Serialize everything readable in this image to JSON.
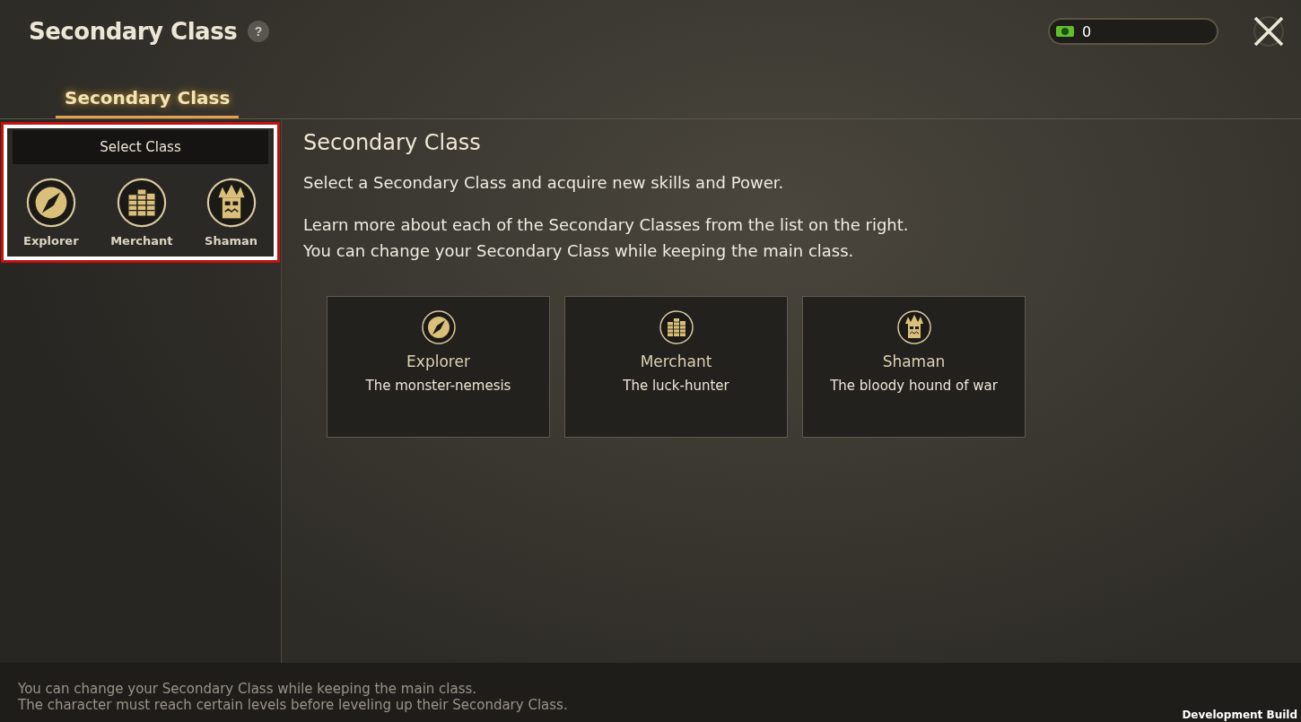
{
  "header": {
    "title": "Secondary Class",
    "help": "?",
    "currency": "0"
  },
  "tabs": [
    {
      "label": "Secondary Class",
      "selected": true
    }
  ],
  "class_select": {
    "title": "Select Class",
    "highlighted": true,
    "classes": [
      {
        "name": "Explorer",
        "kind": "compass"
      },
      {
        "name": "Merchant",
        "kind": "coins"
      },
      {
        "name": "Shaman",
        "kind": "mask"
      }
    ]
  },
  "content": {
    "heading": "Secondary Class",
    "intro": "Select a Secondary Class and acquire new skills and Power.",
    "details": [
      "Learn more about each of the Secondary Classes from the list on the right.",
      "You can change your Secondary Class while keeping the main class."
    ],
    "cards": [
      {
        "name": "Explorer",
        "tagline": "The monster-nemesis",
        "kind": "compass"
      },
      {
        "name": "Merchant",
        "tagline": "The luck-hunter",
        "kind": "coins"
      },
      {
        "name": "Shaman",
        "tagline": "The bloody hound of war",
        "kind": "mask"
      }
    ]
  },
  "footer": {
    "notes": [
      "You can change your Secondary Class while keeping the main class.",
      "The character must reach certain levels before leveling up their Secondary Class."
    ],
    "build": "Development Build"
  }
}
